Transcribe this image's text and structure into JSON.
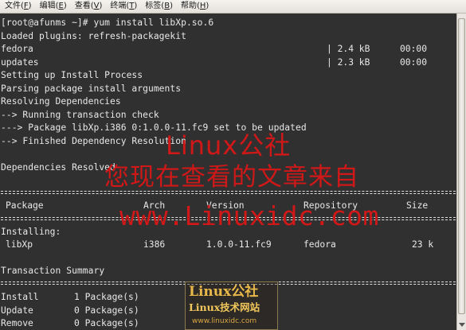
{
  "menu": {
    "items": [
      {
        "label": "文件",
        "accel": "F"
      },
      {
        "label": "编辑",
        "accel": "E"
      },
      {
        "label": "查看",
        "accel": "V"
      },
      {
        "label": "终端",
        "accel": "T"
      },
      {
        "label": "标签",
        "accel": "B"
      },
      {
        "label": "帮助",
        "accel": "H"
      }
    ]
  },
  "terminal": {
    "prompt_line": "[root@afunms ~]# yum install libXp.so.6",
    "loaded_plugins": "Loaded plugins: refresh-packagekit",
    "repos": [
      {
        "name": "fedora",
        "size": "| 2.4 kB",
        "time": "00:00"
      },
      {
        "name": "updates",
        "size": "| 2.3 kB",
        "time": "00:00"
      }
    ],
    "setup": "Setting up Install Process",
    "parsing": "Parsing package install arguments",
    "resolving": "Resolving Dependencies",
    "running_check": "--> Running transaction check",
    "package_line": "---> Package libXp.i386 0:1.0.0-11.fc9 set to be updated",
    "finished": "--> Finished Dependency Resolution",
    "deps_resolved": "Dependencies Resolved",
    "table": {
      "headers": {
        "package": "Package",
        "arch": "Arch",
        "version": "Version",
        "repository": "Repository",
        "size": "Size"
      },
      "installing_label": "Installing:",
      "rows": [
        {
          "package": "libXp",
          "arch": "i386",
          "version": "1.0.0-11.fc9",
          "repository": "fedora",
          "size": "23 k"
        }
      ]
    },
    "summary_title": "Transaction Summary",
    "summary": [
      {
        "action": "Install",
        "count": "1 Package(s)"
      },
      {
        "action": "Update",
        "count": "0 Package(s)"
      },
      {
        "action": "Remove",
        "count": "0 Package(s)"
      }
    ]
  },
  "watermark": {
    "line1": "Linux公社",
    "line2": "您现在查看的文章来自",
    "line3": "www.Linuxidc.com",
    "logo_title": "Linux公社",
    "logo_subtitle": "Linux技术网站",
    "logo_url": "www.linuxidc.com"
  },
  "colors": {
    "terminal_bg": "#303030",
    "terminal_fg": "#e8e8e8",
    "watermark_red": "#d01818",
    "logo_gold": "#e9b84a"
  }
}
